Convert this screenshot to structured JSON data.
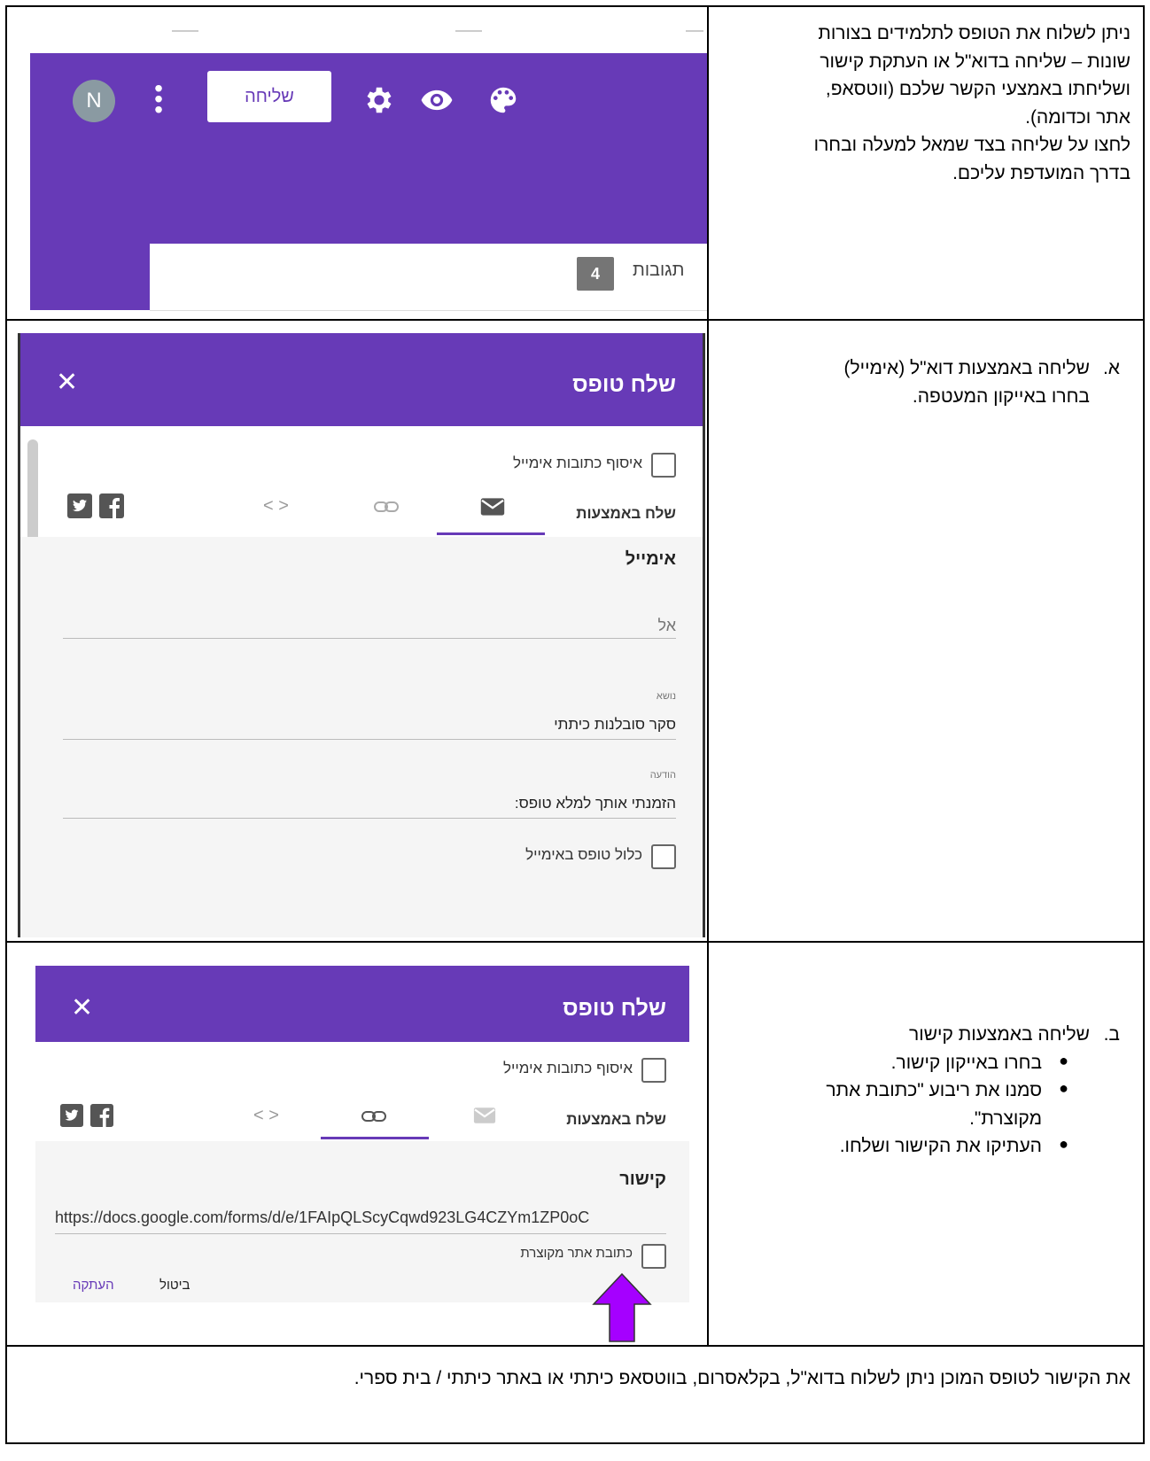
{
  "row1": {
    "text_lines": [
      "ניתן לשלוח את הטופס לתלמידים בצורות",
      "שונות – שליחה בדוא\"ל או העתקת קישור",
      "ושליחתו באמצעי הקשר שלכם (ווטסאפ,",
      "אתר וכדומה).",
      "לחצו על שליחה בצד שמאל למעלה ובחרו",
      "בדרך המועדפת עליכם."
    ],
    "screenshot": {
      "avatar_letter": "N",
      "send_button": "שליחה",
      "responses_label": "תגובות",
      "responses_count": "4",
      "icons": [
        "more-vert-icon",
        "gear-icon",
        "eye-icon",
        "palette-icon"
      ]
    }
  },
  "row2": {
    "item_marker": "א.",
    "item_text": "שליחה באמצעות דוא\"ל (אימייל)",
    "sub_text": "בחרו באייקון המעטפה.",
    "dialog": {
      "title": "שלח טופס",
      "collect_emails": "איסוף כתובות אימייל",
      "send_via": "שלח באמצעות",
      "section_title": "אימייל",
      "to_label": "אל",
      "subject_label": "נושא",
      "subject_value": "סקר סובלנות כיתתי",
      "message_label": "הודעה",
      "message_value": "הזמנתי אותך למלא טופס:",
      "include_form": "כלול טופס באימייל"
    }
  },
  "row3": {
    "item_marker": "ב.",
    "item_text": "שליחה באמצעות קישור",
    "bullets": [
      "בחרו באייקון קישור.",
      "סמנו את ריבוע \"כתובת אתר",
      "מקוצרת\".",
      "העתיקו את הקישור ושלחו."
    ],
    "bullet_marker": "●",
    "dialog": {
      "title": "שלח טופס",
      "collect_emails": "איסוף כתובות אימייל",
      "send_via": "שלח באמצעות",
      "section_title": "קישור",
      "link_value": "https://docs.google.com/forms/d/e/1FAIpQLScyCqwd923LG4CZYm1ZP0oC",
      "shorten_label": "כתובת אתר מקוצרת",
      "cancel": "ביטול",
      "copy": "העתקה"
    },
    "arrow_color": "#a500ff"
  },
  "row4": {
    "text": "את הקישור לטופס המוכן ניתן לשלוח בדוא\"ל, בקלאסרום, בווטסאפ כיתתי או באתר כיתתי / בית ספרי."
  },
  "colors": {
    "purple": "#673ab7",
    "arrow": "#a500ff"
  }
}
